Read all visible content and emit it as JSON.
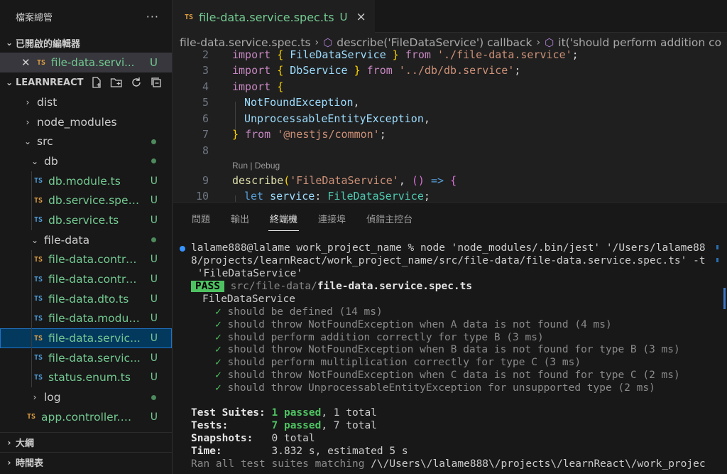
{
  "sidebar": {
    "title": "檔案總管",
    "more": "···",
    "open_editors_label": "已開啟的編輯器",
    "open_editor": {
      "badge": "TS",
      "name": "file-data.servi...",
      "status": "U"
    },
    "project_label": "LEARNREACT",
    "tree": [
      {
        "name": "dist",
        "type": "folder",
        "open": false,
        "depth": 1,
        "status": ""
      },
      {
        "name": "node_modules",
        "type": "folder",
        "open": false,
        "depth": 1,
        "status": ""
      },
      {
        "name": "src",
        "type": "folder",
        "open": true,
        "depth": 1,
        "status": "dot"
      },
      {
        "name": "db",
        "type": "folder",
        "open": true,
        "depth": 2,
        "status": "dot"
      },
      {
        "name": "db.module.ts",
        "type": "file",
        "badge": "TS",
        "badge_color": "blue",
        "depth": 3,
        "status": "U"
      },
      {
        "name": "db.service.spec...",
        "type": "file",
        "badge": "TS",
        "badge_color": "orange",
        "depth": 3,
        "status": "U"
      },
      {
        "name": "db.service.ts",
        "type": "file",
        "badge": "TS",
        "badge_color": "blue",
        "depth": 3,
        "status": "U"
      },
      {
        "name": "file-data",
        "type": "folder",
        "open": true,
        "depth": 2,
        "status": "dot"
      },
      {
        "name": "file-data.contro...",
        "type": "file",
        "badge": "TS",
        "badge_color": "orange",
        "depth": 3,
        "status": "U"
      },
      {
        "name": "file-data.contro...",
        "type": "file",
        "badge": "TS",
        "badge_color": "blue",
        "depth": 3,
        "status": "U"
      },
      {
        "name": "file-data.dto.ts",
        "type": "file",
        "badge": "TS",
        "badge_color": "blue",
        "depth": 3,
        "status": "U"
      },
      {
        "name": "file-data.modul...",
        "type": "file",
        "badge": "TS",
        "badge_color": "blue",
        "depth": 3,
        "status": "U"
      },
      {
        "name": "file-data.servic...",
        "type": "file",
        "badge": "TS",
        "badge_color": "orange",
        "depth": 3,
        "status": "U",
        "selected": true
      },
      {
        "name": "file-data.servic...",
        "type": "file",
        "badge": "TS",
        "badge_color": "blue",
        "depth": 3,
        "status": "U"
      },
      {
        "name": "status.enum.ts",
        "type": "file",
        "badge": "TS",
        "badge_color": "blue",
        "depth": 3,
        "status": "U"
      },
      {
        "name": "log",
        "type": "folder",
        "open": false,
        "depth": 2,
        "status": "dot"
      },
      {
        "name": "app.controller.sp...",
        "type": "file",
        "badge": "TS",
        "badge_color": "orange",
        "depth": 2,
        "status": "U"
      }
    ],
    "outline_label": "大綱",
    "timeline_label": "時間表"
  },
  "editor": {
    "tab": {
      "badge": "TS",
      "name": "file-data.service.spec.ts",
      "status": "U",
      "close": "×"
    },
    "breadcrumb": {
      "file": "file-data.service.spec.ts",
      "symbol1": "describe('FileDataService') callback",
      "symbol2": "it('should perform addition co"
    },
    "codelens": "Run | Debug",
    "lines": {
      "l2": {
        "num": "2",
        "a": "import ",
        "b": "{ ",
        "c": "FileDataService",
        "d": " } ",
        "e": "from ",
        "f": "'./file-data.service'",
        "g": ";"
      },
      "l3": {
        "num": "3",
        "a": "import ",
        "b": "{ ",
        "c": "DbService",
        "d": " } ",
        "e": "from ",
        "f": "'../db/db.service'",
        "g": ";"
      },
      "l4": {
        "num": "4",
        "a": "import ",
        "b": "{"
      },
      "l5": {
        "num": "5",
        "c": "NotFoundException",
        "g": ","
      },
      "l6": {
        "num": "6",
        "c": "UnprocessableEntityException",
        "g": ","
      },
      "l7": {
        "num": "7",
        "b": "} ",
        "e": "from ",
        "f": "'@nestjs/common'",
        "g": ";"
      },
      "l8": {
        "num": "8"
      },
      "l9": {
        "num": "9",
        "a": "describe",
        "b": "(",
        "f": "'FileDataService'",
        "g": ", ",
        "h": "() ",
        "i": "=> ",
        "j": "{"
      },
      "l10": {
        "num": "10",
        "a": "let ",
        "c": "service",
        "g": ": ",
        "t": "FileDataService",
        "z": ";"
      }
    }
  },
  "panel": {
    "tabs": [
      "問題",
      "輸出",
      "終端機",
      "連接埠",
      "偵錯主控台"
    ],
    "active_tab": "終端機",
    "terminal": {
      "cmd1": "lalame888@lalame work_project_name % node 'node_modules/.bin/jest' '/Users/lalame88",
      "cmd2": "8/projects/learnReact/work_project_name/src/file-data/file-data.service.spec.ts' -t",
      "cmd3": " 'FileDataService'",
      "pass": "PASS",
      "pass_path": "src/file-data/",
      "pass_file": "file-data.service.spec.ts",
      "suite": "FileDataService",
      "tests": [
        "should be defined (14 ms)",
        "should throw NotFoundException when A data is not found (4 ms)",
        "should perform addition correctly for type B (3 ms)",
        "should throw NotFoundException when B data is not found for type B (3 ms)",
        "should perform multiplication correctly for type C (3 ms)",
        "should throw NotFoundException when C data is not found for type C (2 ms)",
        "should throw UnprocessableEntityException for unsupported type (2 ms)"
      ],
      "check": "✓",
      "suites_label": "Test Suites:",
      "suites_passed": "1 passed",
      "suites_total": ", 1 total",
      "tests_label": "Tests:",
      "tests_passed": "7 passed",
      "tests_total": ", 7 total",
      "snapshots_label": "Snapshots:",
      "snapshots_value": "0 total",
      "time_label": "Time:",
      "time_value": "3.832 s, estimated 5 s",
      "ran_label": "Ran all test suites matching ",
      "ran_value": "/\\/Users\\/lalame888\\/projects\\/learnReact\\/work_projec"
    }
  },
  "colors": {
    "accent": "#3794ff",
    "ts_blue": "#4fa0dd",
    "ts_orange": "#e2a043",
    "git_untracked": "#73c991",
    "pass": "#4ec261"
  }
}
